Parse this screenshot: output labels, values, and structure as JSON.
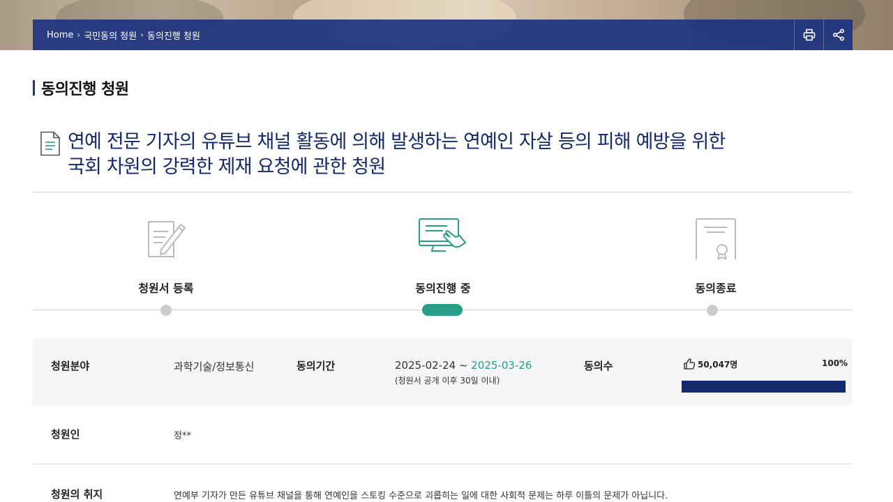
{
  "breadcrumb": {
    "home": "Home",
    "level1": "국민동의 청원",
    "level2": "동의진행 청원",
    "separator": "›"
  },
  "toolbar": {
    "print_icon": "print-icon",
    "share_icon": "share-icon"
  },
  "page_title": "동의진행 청원",
  "petition": {
    "title_line1": "연예 전문 기자의 유튜브 채널 활동에 의해 발생하는 연예인 자살 등의 피해 예방을 위한",
    "title_line2": "국회 차원의 강력한 제재 요청에 관한 청원"
  },
  "steps": [
    {
      "label": "청원서 등록",
      "icon": "document-pen-icon",
      "active": false
    },
    {
      "label": "동의진행 중",
      "icon": "monitor-click-icon",
      "active": true
    },
    {
      "label": "동의종료",
      "icon": "certificate-icon",
      "active": false
    }
  ],
  "info": {
    "category_label": "청원분야",
    "category_value": "과학기술/정보통신",
    "period_label": "동의기간",
    "period_start": "2025-02-24",
    "period_sep": " ~ ",
    "period_end": "2025-03-26",
    "period_note": "(청원서 공개 이후 30일 이내)",
    "votes_label": "동의수",
    "votes_value": "50,047명",
    "votes_percent": "100%",
    "progress_fraction": 1.0
  },
  "petitioner": {
    "label": "청원인",
    "value": "정**"
  },
  "purpose": {
    "label": "청원의 취지",
    "value": "연예부 기자가 만든 유튜브 채널을 통해 연예인을 스토킹 수준으로 괴롭히는 일에 대한 사회적 문제는 하루 이틀의 문제가 아닙니다."
  },
  "colors": {
    "navy": "#14296b",
    "breadcrumb_bg": "#1e3480",
    "accent_green": "#2a9d87",
    "inactive_dot": "#cccccc"
  }
}
